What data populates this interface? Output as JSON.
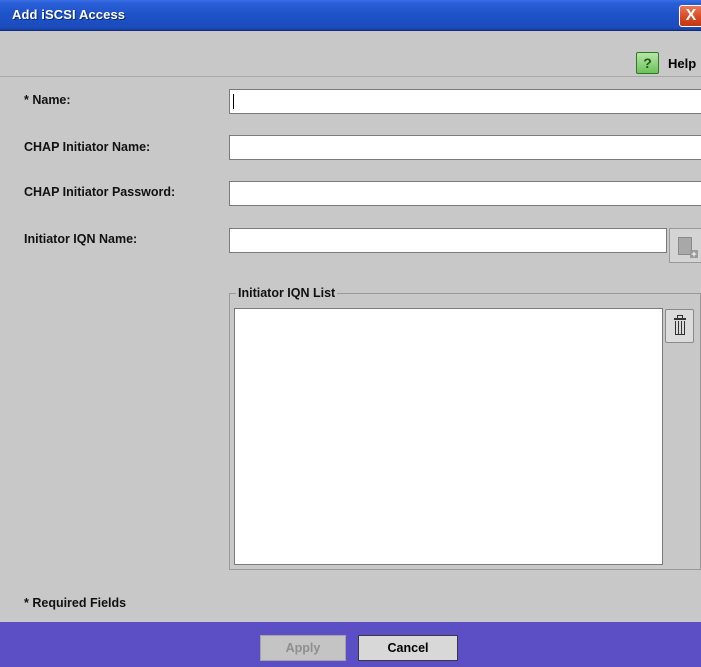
{
  "window": {
    "title": "Add iSCSI Access",
    "close_glyph": "X"
  },
  "toolbar": {
    "help_icon": "help-icon",
    "help_glyph": "?",
    "help_label": "Help"
  },
  "form": {
    "name_label": "* Name:",
    "name_value": "",
    "chap_initiator_name_label": "CHAP Initiator Name:",
    "chap_initiator_name_value": "",
    "chap_initiator_password_label": "CHAP Initiator Password:",
    "chap_initiator_password_value": "",
    "initiator_iqn_name_label": "Initiator IQN Name:",
    "initiator_iqn_name_value": "",
    "add_icon": "add-document-icon",
    "iqn_list_legend": "Initiator IQN List",
    "iqn_list_items": [],
    "delete_icon": "trash-icon"
  },
  "required_note": "* Required Fields",
  "buttons": {
    "apply_label": "Apply",
    "apply_enabled": false,
    "cancel_label": "Cancel"
  },
  "colors": {
    "titlebar": "#1e52c8",
    "footer": "#5c4ec4",
    "background": "#c8c8c8",
    "close": "#d84a22",
    "help": "#6cc25a"
  }
}
